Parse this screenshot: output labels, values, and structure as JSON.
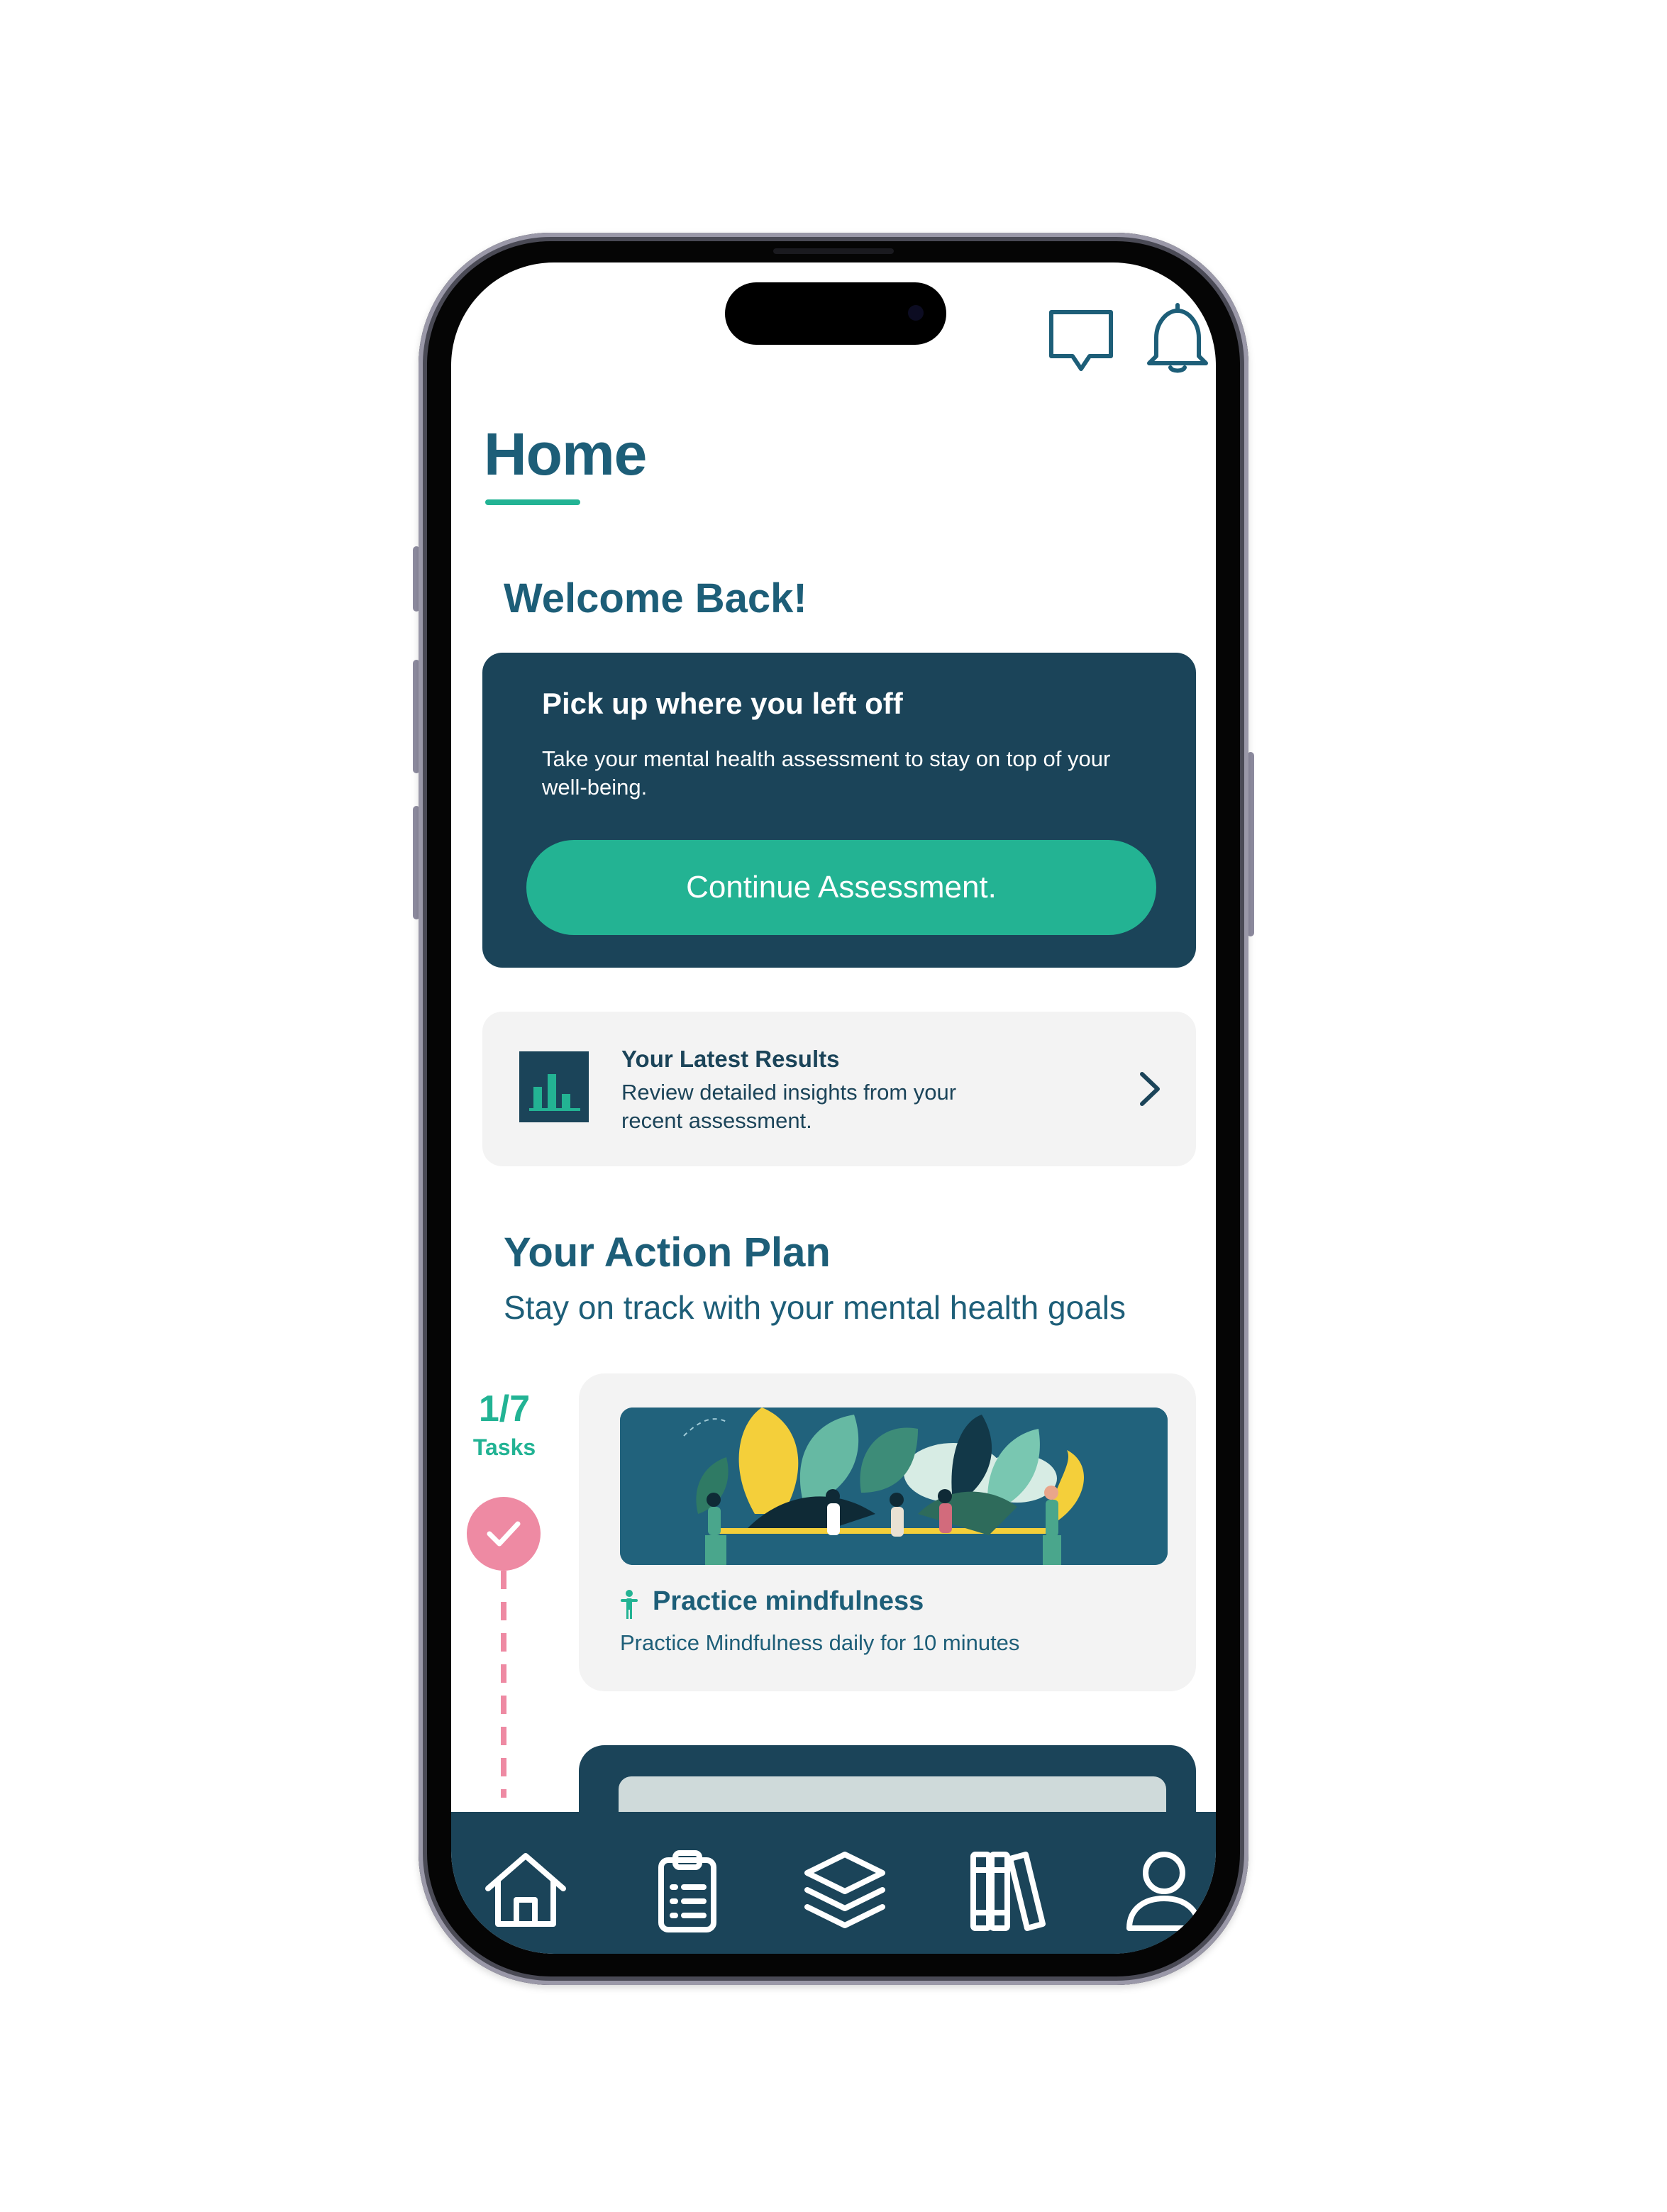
{
  "header": {
    "icons": [
      "chat-icon",
      "bell-icon"
    ]
  },
  "page": {
    "title": "Home",
    "welcome": "Welcome Back!"
  },
  "assessment_card": {
    "heading": "Pick up where you left off",
    "body": "Take your mental health assessment to stay on top of your well-being.",
    "button_label": "Continue Assessment."
  },
  "results_card": {
    "title": "Your Latest Results",
    "description": "Review detailed insights from your recent assessment.",
    "icon": "bar-chart-icon"
  },
  "action_plan": {
    "title": "Your Action Plan",
    "subtitle": "Stay on track with your mental health goals",
    "task_count": "1/7",
    "task_label": "Tasks",
    "tasks": [
      {
        "title": "Practice mindfulness",
        "description": "Practice Mindfulness daily for 10 minutes",
        "icon": "person-icon",
        "completed": true
      }
    ]
  },
  "bottom_nav": {
    "items": [
      "home-icon",
      "clipboard-icon",
      "layers-icon",
      "library-icon",
      "profile-icon"
    ]
  },
  "colors": {
    "primary_dark": "#1b4459",
    "title_teal": "#1d5e78",
    "accent_green": "#23b393",
    "accent_pink": "#ee8aa3",
    "card_gray": "#f3f3f3"
  }
}
